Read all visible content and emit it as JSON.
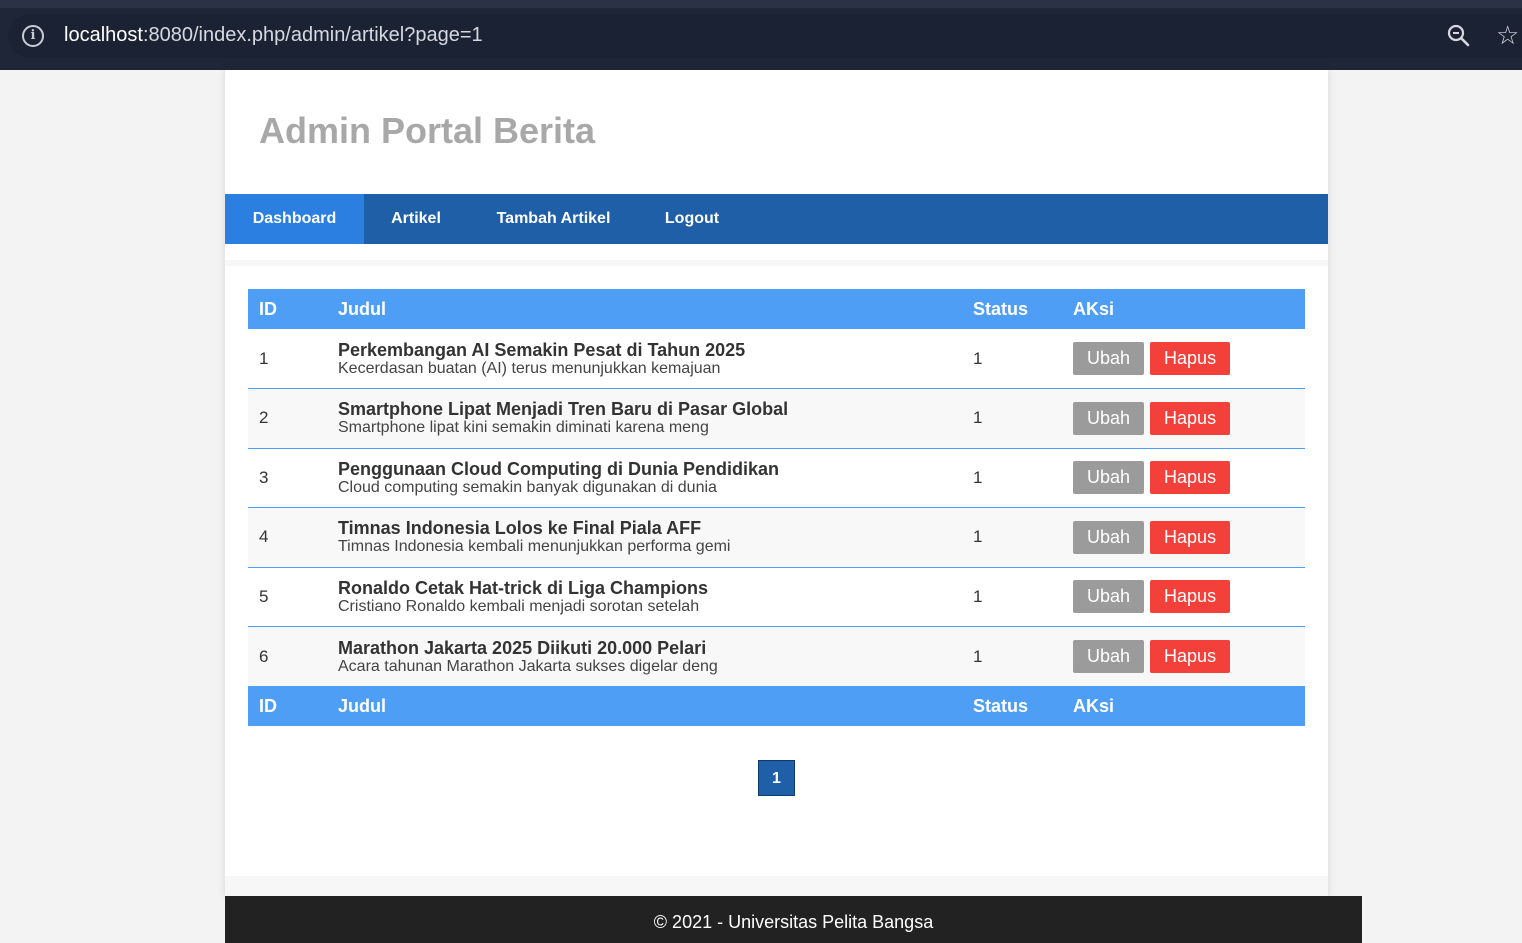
{
  "browser": {
    "url_host": "localhost",
    "url_rest": ":8080/index.php/admin/artikel?page=1",
    "info_icon": "info-icon",
    "zoom_icon": "zoom-icon",
    "star_icon": "star-icon"
  },
  "site": {
    "title": "Admin Portal Berita"
  },
  "nav": {
    "items": [
      {
        "label": "Dashboard",
        "active": true
      },
      {
        "label": "Artikel"
      },
      {
        "label": "Tambah Artikel"
      },
      {
        "label": "Logout"
      }
    ]
  },
  "table": {
    "headers": [
      "ID",
      "Judul",
      "Status",
      "AKsi"
    ],
    "rows": [
      {
        "id": "1",
        "title": "Perkembangan AI Semakin Pesat di Tahun 2025",
        "desc": "Kecerdasan buatan (AI) terus menunjukkan kemajuan",
        "status": "1",
        "edit": "Ubah",
        "delete": "Hapus"
      },
      {
        "id": "2",
        "title": "Smartphone Lipat Menjadi Tren Baru di Pasar Global",
        "desc": "Smartphone lipat kini semakin diminati karena meng",
        "status": "1",
        "edit": "Ubah",
        "delete": "Hapus"
      },
      {
        "id": "3",
        "title": "Penggunaan Cloud Computing di Dunia Pendidikan",
        "desc": "Cloud computing semakin banyak digunakan di dunia",
        "status": "1",
        "edit": "Ubah",
        "delete": "Hapus"
      },
      {
        "id": "4",
        "title": "Timnas Indonesia Lolos ke Final Piala AFF",
        "desc": "Timnas Indonesia kembali menunjukkan performa gemi",
        "status": "1",
        "edit": "Ubah",
        "delete": "Hapus"
      },
      {
        "id": "5",
        "title": "Ronaldo Cetak Hat-trick di Liga Champions",
        "desc": "Cristiano Ronaldo kembali menjadi sorotan setelah",
        "status": "1",
        "edit": "Ubah",
        "delete": "Hapus"
      },
      {
        "id": "6",
        "title": "Marathon Jakarta 2025 Diikuti 20.000 Pelari",
        "desc": "Acara tahunan Marathon Jakarta sukses digelar deng",
        "status": "1",
        "edit": "Ubah",
        "delete": "Hapus"
      }
    ]
  },
  "pagination": {
    "current": "1"
  },
  "footer": {
    "text": "© 2021 - Universitas Pelita Bangsa"
  },
  "colors": {
    "nav": "#1e5fa8",
    "nav_active": "#2b7fe0",
    "table_header": "#4f9ef5",
    "btn_edit": "#9b9b9b",
    "btn_delete": "#f3403a",
    "footer": "#222222"
  }
}
